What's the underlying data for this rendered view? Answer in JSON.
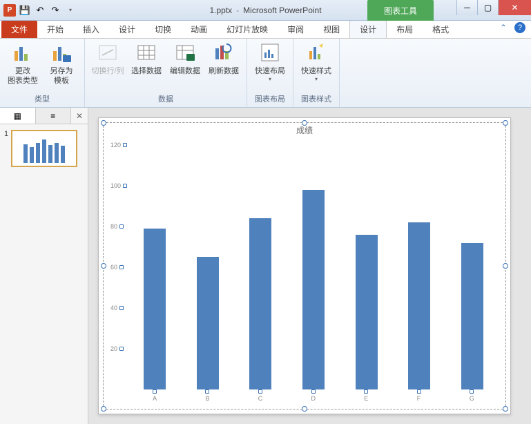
{
  "titlebar": {
    "filename": "1.pptx",
    "separator": "-",
    "app": "Microsoft PowerPoint",
    "chart_tools": "图表工具"
  },
  "tabs": {
    "file": "文件",
    "home": "开始",
    "insert": "插入",
    "design_main": "设计",
    "transitions": "切换",
    "animations": "动画",
    "slideshow": "幻灯片放映",
    "review": "审阅",
    "view": "视图",
    "design": "设计",
    "layout": "布局",
    "format": "格式"
  },
  "ribbon": {
    "group_type": "类型",
    "group_data": "数据",
    "group_layout": "图表布局",
    "group_style": "图表样式",
    "change_type": "更改\n图表类型",
    "save_template": "另存为\n模板",
    "switch_rc": "切换行/列",
    "select_data": "选择数据",
    "edit_data": "编辑数据",
    "refresh_data": "刷新数据",
    "quick_layout": "快速布局",
    "quick_style": "快速样式"
  },
  "outline": {
    "slide_num": "1"
  },
  "chart_data": {
    "type": "bar",
    "title": "成绩",
    "categories": [
      "A",
      "B",
      "C",
      "D",
      "E",
      "F",
      "G"
    ],
    "values": [
      79,
      65,
      84,
      98,
      76,
      82,
      72
    ],
    "y_ticks": [
      20,
      40,
      60,
      80,
      100,
      120
    ],
    "ylim": [
      0,
      120
    ],
    "xlabel": "",
    "ylabel": ""
  }
}
